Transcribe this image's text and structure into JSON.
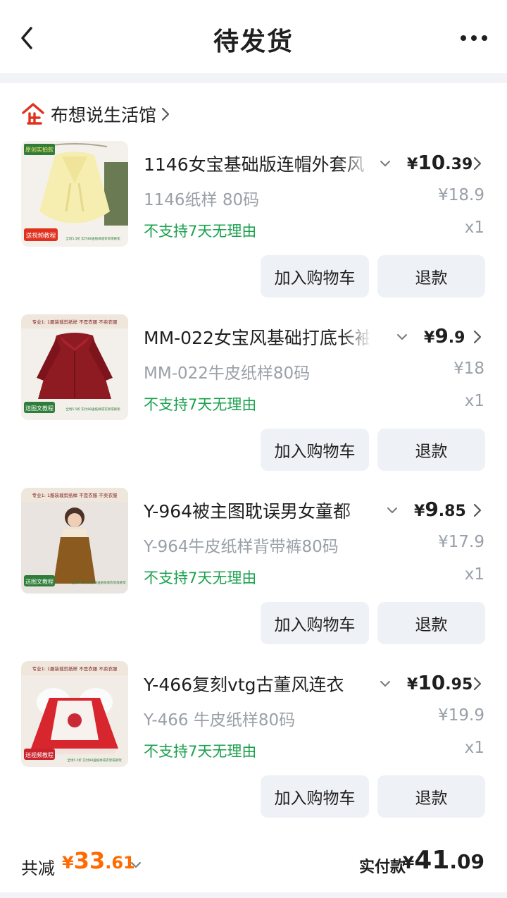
{
  "header": {
    "title": "待发货"
  },
  "shop": {
    "name": "布想说生活馆"
  },
  "items": [
    {
      "name": "1146女宝基础版连帽外套风",
      "price": {
        "currency": "¥",
        "int": "10",
        "dec": ".39"
      },
      "spec": "1146纸样 80码",
      "original_price": "¥18.9",
      "policy": "不支持7天无理由",
      "qty": "x1",
      "cart_label": "加入购物车",
      "refund_label": "退款",
      "thumb": {
        "top_tag": "原创实拍款",
        "bottom_tag": "送视频教程",
        "promo": "全场5.5折 实付88送纸样或衣架或裤架"
      }
    },
    {
      "name": "MM-022女宝风基础打底长袖",
      "price": {
        "currency": "¥",
        "int": "9",
        "dec": ".9"
      },
      "spec": "MM-022牛皮纸样80码",
      "original_price": "¥18",
      "policy": "不支持7天无理由",
      "qty": "x1",
      "cart_label": "加入购物车",
      "refund_label": "退款",
      "thumb": {
        "top_tag": "专业1: 1服装裁剪纸样 不是衣服 不卖衣服",
        "bottom_tag": "送图文教程",
        "promo": "全场5.5折 实付88送纸样或衣架或裤架"
      }
    },
    {
      "name": "Y-964被主图耽误男女童都",
      "price": {
        "currency": "¥",
        "int": "9",
        "dec": ".85"
      },
      "spec": "Y-964牛皮纸样背带裤80码",
      "original_price": "¥17.9",
      "policy": "不支持7天无理由",
      "qty": "x1",
      "cart_label": "加入购物车",
      "refund_label": "退款",
      "thumb": {
        "top_tag": "专业1: 1服装裁剪纸样 不是衣服 不卖衣服",
        "bottom_tag": "送图文教程",
        "promo": "全场5.5折 实付88送纸样或衣架或裤架"
      }
    },
    {
      "name": "Y-466复刻vtg古董风连衣",
      "price": {
        "currency": "¥",
        "int": "10",
        "dec": ".95"
      },
      "spec": "Y-466 牛皮纸样80码",
      "original_price": "¥19.9",
      "policy": "不支持7天无理由",
      "qty": "x1",
      "cart_label": "加入购物车",
      "refund_label": "退款",
      "thumb": {
        "top_tag": "专业1: 1服装裁剪纸样 不是衣服 不卖衣服",
        "bottom_tag": "送视频教程",
        "promo": "全场5.5折 实付88送纸样或衣架或裤架"
      }
    }
  ],
  "footer": {
    "discount_label": "共减",
    "discount": {
      "currency": "¥",
      "int": "33",
      "dec": ".61"
    },
    "paid_label": "实付款",
    "paid": {
      "currency": "¥",
      "int": "41",
      "dec": ".09"
    }
  },
  "colors": {
    "accent_orange": "#ff6a00",
    "policy_green": "#1aa14d",
    "shop_logo_red": "#e0301e",
    "button_bg": "#eef1f5"
  },
  "icons": [
    "back-arrow-icon",
    "more-dots-icon",
    "shop-logo-icon",
    "chevron-right-icon",
    "chevron-down-icon"
  ]
}
